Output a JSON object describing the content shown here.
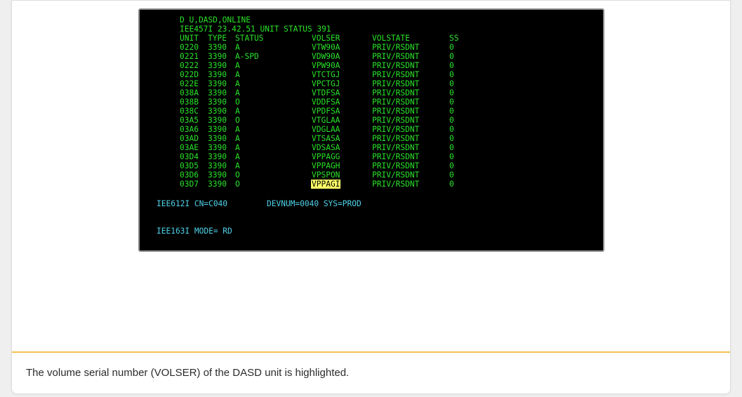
{
  "terminal": {
    "command": "D U,DASD,ONLINE",
    "status_header": "IEE457I 23.42.51 UNIT STATUS 391",
    "columns": {
      "unit": "UNIT",
      "type": "TYPE",
      "status": "STATUS",
      "volser": "VOLSER",
      "volstate": "VOLSTATE",
      "ss": "SS"
    },
    "rows": [
      {
        "unit": "0220",
        "type": "3390",
        "status": "A",
        "volser": "VTW90A",
        "volstate": "PRIV/RSDNT",
        "ss": "0"
      },
      {
        "unit": "0221",
        "type": "3390",
        "status": "A-SPD",
        "volser": "VDW90A",
        "volstate": "PRIV/RSDNT",
        "ss": "0"
      },
      {
        "unit": "0222",
        "type": "3390",
        "status": "A",
        "volser": "VPW90A",
        "volstate": "PRIV/RSDNT",
        "ss": "0"
      },
      {
        "unit": "022D",
        "type": "3390",
        "status": "A",
        "volser": "VTCTGJ",
        "volstate": "PRIV/RSDNT",
        "ss": "0"
      },
      {
        "unit": "022E",
        "type": "3390",
        "status": "A",
        "volser": "VPCTGJ",
        "volstate": "PRIV/RSDNT",
        "ss": "0"
      },
      {
        "unit": "038A",
        "type": "3390",
        "status": "A",
        "volser": "VTDFSA",
        "volstate": "PRIV/RSDNT",
        "ss": "0"
      },
      {
        "unit": "038B",
        "type": "3390",
        "status": "O",
        "volser": "VDDFSA",
        "volstate": "PRIV/RSDNT",
        "ss": "0"
      },
      {
        "unit": "038C",
        "type": "3390",
        "status": "A",
        "volser": "VPDFSA",
        "volstate": "PRIV/RSDNT",
        "ss": "0"
      },
      {
        "unit": "03A5",
        "type": "3390",
        "status": "O",
        "volser": "VTGLAA",
        "volstate": "PRIV/RSDNT",
        "ss": "0"
      },
      {
        "unit": "03A6",
        "type": "3390",
        "status": "A",
        "volser": "VDGLAA",
        "volstate": "PRIV/RSDNT",
        "ss": "0"
      },
      {
        "unit": "03AD",
        "type": "3390",
        "status": "A",
        "volser": "VTSASA",
        "volstate": "PRIV/RSDNT",
        "ss": "0"
      },
      {
        "unit": "03AE",
        "type": "3390",
        "status": "A",
        "volser": "VDSASA",
        "volstate": "PRIV/RSDNT",
        "ss": "0"
      },
      {
        "unit": "03D4",
        "type": "3390",
        "status": "A",
        "volser": "VPPAGG",
        "volstate": "PRIV/RSDNT",
        "ss": "0"
      },
      {
        "unit": "03D5",
        "type": "3390",
        "status": "A",
        "volser": "VPPAGH",
        "volstate": "PRIV/RSDNT",
        "ss": "0"
      },
      {
        "unit": "03D6",
        "type": "3390",
        "status": "O",
        "volser": "VPSPON",
        "volstate": "PRIV/RSDNT",
        "ss": "0"
      },
      {
        "unit": "03D7",
        "type": "3390",
        "status": "O",
        "volser": "VPPAGI",
        "volstate": "PRIV/RSDNT",
        "ss": "0",
        "highlighted": true
      }
    ],
    "msg_cn": "IEE612I CN=C040",
    "msg_devnum": "DEVNUM=0040 SYS=PROD",
    "msg_mode": "IEE163I MODE= RD",
    "colors": {
      "text": "#29e229",
      "info": "#4fd3ea",
      "highlight": "#ffff66"
    }
  },
  "caption": "The volume serial number (VOLSER) of the DASD unit is highlighted."
}
